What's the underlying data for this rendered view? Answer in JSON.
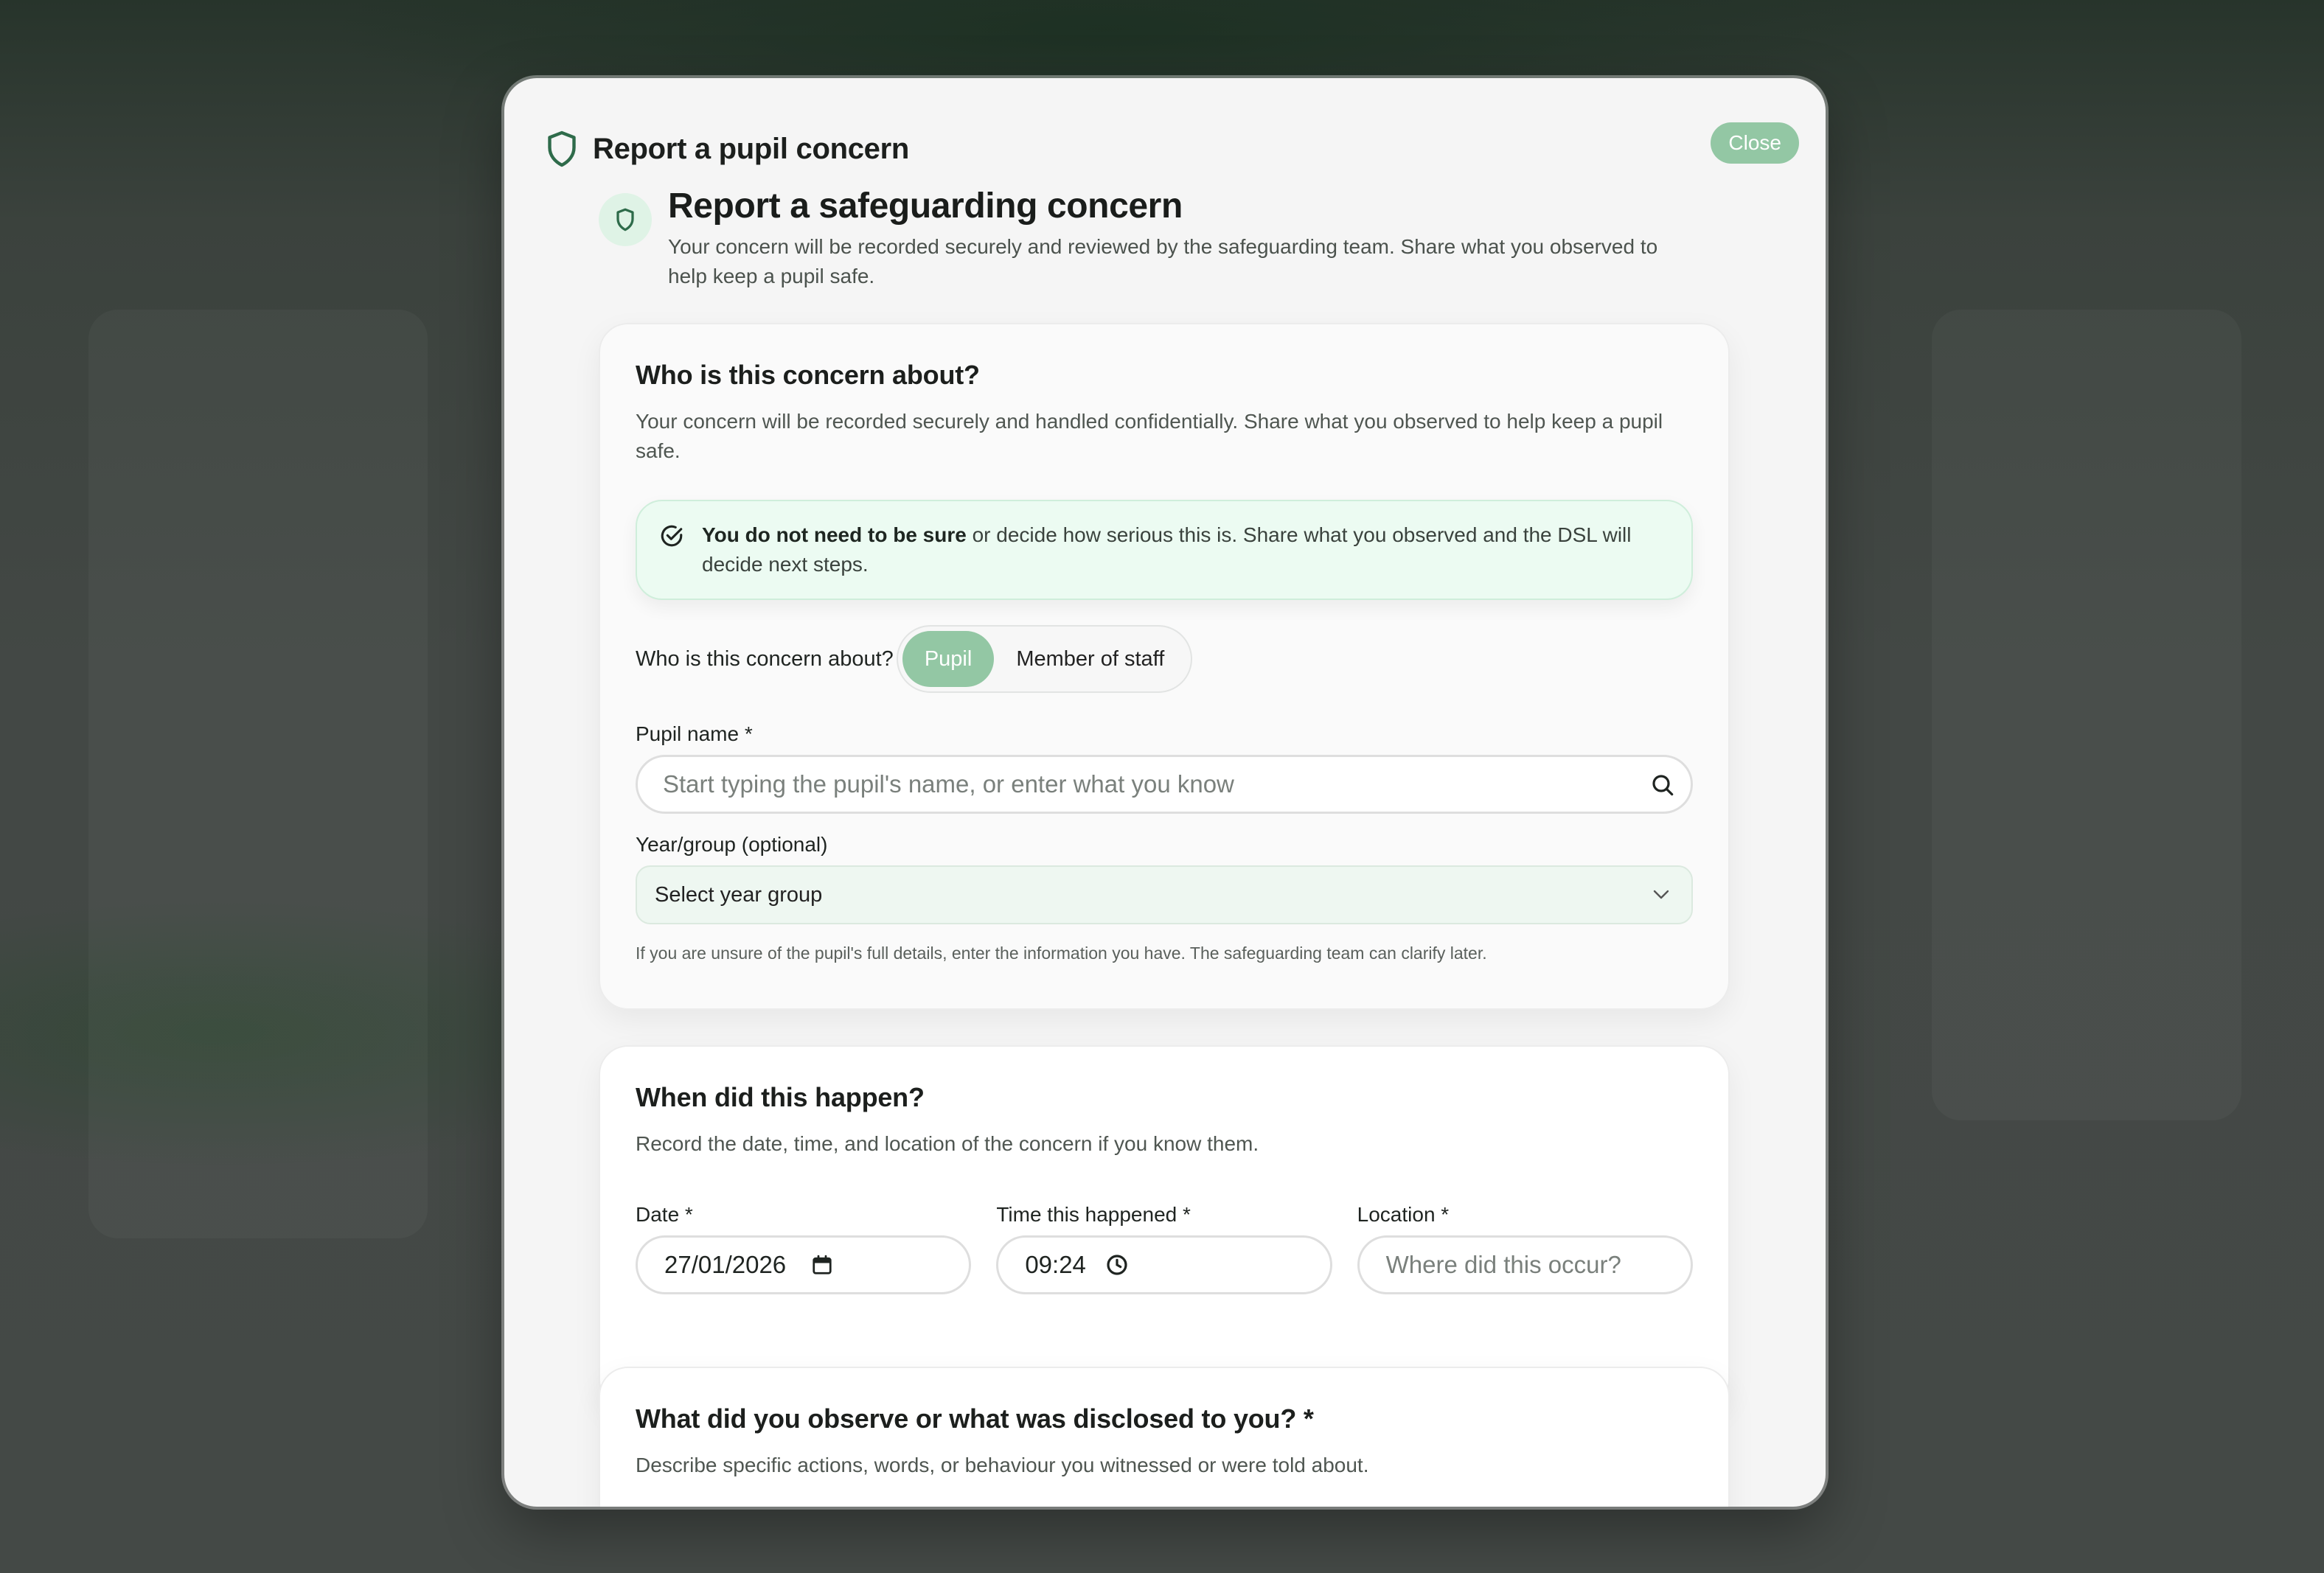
{
  "header": {
    "title": "Report a pupil concern",
    "close_label": "Close"
  },
  "intro": {
    "title": "Report a safeguarding concern",
    "description": "Your concern will be recorded securely and reviewed by the safeguarding team. Share what you observed to help keep a pupil safe."
  },
  "who": {
    "heading": "Who is this concern about?",
    "lead": "Your concern will be recorded securely and handled confidentially. Share what you observed to help keep a pupil safe.",
    "notice_strong": "You do not need to be sure",
    "notice_rest": " or decide how serious this is. Share what you observed and the DSL will decide next steps.",
    "toggle_label": "Who is this concern about?",
    "options": [
      "Pupil",
      "Member of staff"
    ],
    "selected": "Pupil",
    "pupil_name_label": "Pupil name *",
    "pupil_name_placeholder": "Start typing the pupil's name, or enter what you know",
    "year_label": "Year/group (optional)",
    "year_value": "Select year group",
    "hint": "If you are unsure of the pupil's full details, enter the information you have. The safeguarding team can clarify later."
  },
  "when": {
    "heading": "When did this happen?",
    "lead": "Record the date, time, and location of the concern if you know them.",
    "date_label": "Date *",
    "date_value": "27/01/2026",
    "time_label": "Time this happened *",
    "time_value": "09:24",
    "location_label": "Location *",
    "location_placeholder": "Where did this occur?"
  },
  "observe": {
    "heading": "What did you observe or what was disclosed to you? *",
    "lead": "Describe specific actions, words, or behaviour you witnessed or were told about."
  },
  "colors": {
    "accent": "#93c7a4",
    "accent_dark": "#2e6b4a",
    "notice_bg": "#ecfbf2"
  }
}
